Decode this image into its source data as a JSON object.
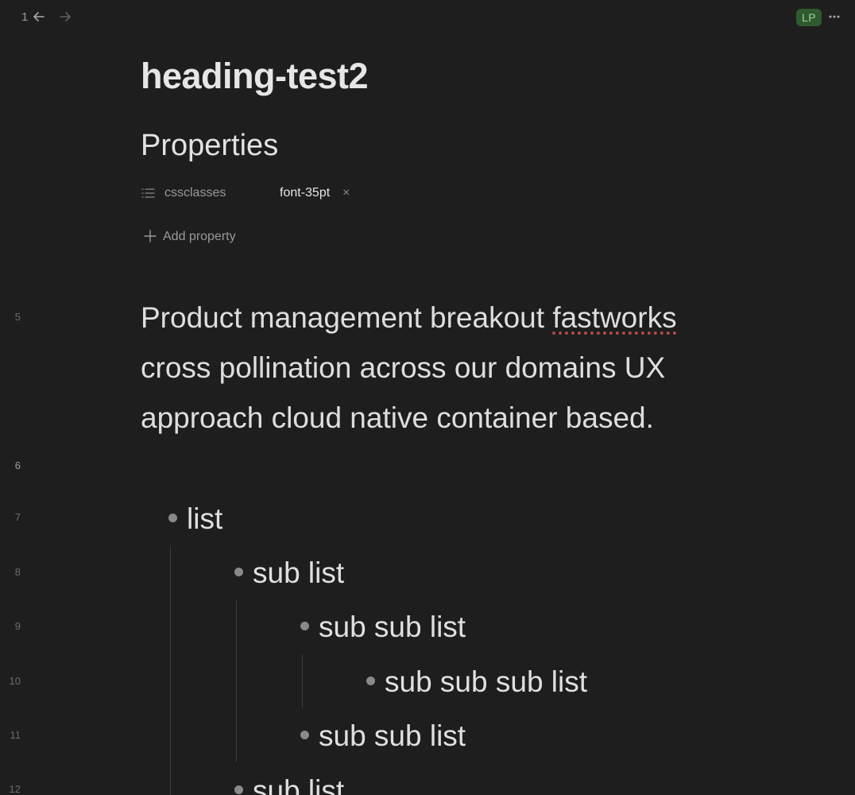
{
  "topbar": {
    "history_count": "1",
    "back_icon": "arrow-left-icon",
    "forward_icon": "arrow-right-icon",
    "avatar_initials": "LP",
    "avatar_color": "#2f5a2f",
    "more_icon": "more-horizontal-icon"
  },
  "note": {
    "title": "heading-test2"
  },
  "properties": {
    "heading": "Properties",
    "items": [
      {
        "key": "cssclasses",
        "icon": "list-icon",
        "value": "font-35pt",
        "remove_glyph": "×"
      }
    ],
    "add_label": "Add property",
    "add_icon": "plus-icon"
  },
  "editor": {
    "line_numbers": [
      "5",
      "6",
      "7",
      "8",
      "9",
      "10",
      "11",
      "12"
    ],
    "paragraph": {
      "before": "Product management breakout ",
      "misspelled": "fastworks",
      "after": " cross pollination across our domains UX approach cloud native container based."
    },
    "list": [
      {
        "text": "list",
        "level": 0
      },
      {
        "text": "sub list",
        "level": 1
      },
      {
        "text": "sub sub list",
        "level": 2
      },
      {
        "text": "sub sub sub list",
        "level": 3
      },
      {
        "text": "sub sub list",
        "level": 2
      },
      {
        "text": "sub list",
        "level": 1
      }
    ]
  }
}
